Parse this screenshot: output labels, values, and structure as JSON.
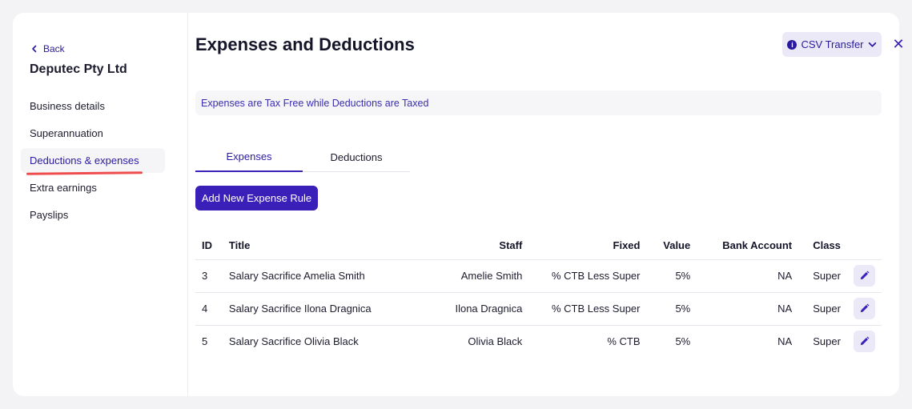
{
  "sidebar": {
    "back_label": "Back",
    "company": "Deputec Pty Ltd",
    "items": [
      {
        "label": "Business details"
      },
      {
        "label": "Superannuation"
      },
      {
        "label": "Deductions & expenses"
      },
      {
        "label": "Extra earnings"
      },
      {
        "label": "Payslips"
      }
    ],
    "active_index": 2
  },
  "header": {
    "title": "Expenses and Deductions",
    "csv_button": "CSV Transfer"
  },
  "banner": "Expenses are Tax Free while Deductions are Taxed",
  "tabs": [
    {
      "label": "Expenses"
    },
    {
      "label": "Deductions"
    }
  ],
  "add_button": "Add New Expense Rule",
  "table": {
    "headers": [
      "ID",
      "Title",
      "Staff",
      "Fixed",
      "Value",
      "Bank Account",
      "Class"
    ],
    "rows": [
      {
        "id": "3",
        "title": "Salary Sacrifice Amelia Smith",
        "staff": "Amelie Smith",
        "fixed": "% CTB Less Super",
        "value": "5%",
        "bank": "NA",
        "class": "Super"
      },
      {
        "id": "4",
        "title": "Salary Sacrifice Ilona Dragnica",
        "staff": "Ilona Dragnica",
        "fixed": "% CTB Less Super",
        "value": "5%",
        "bank": "NA",
        "class": "Super"
      },
      {
        "id": "5",
        "title": "Salary Sacrifice Olivia Black",
        "staff": "Olivia Black",
        "fixed": "% CTB",
        "value": "5%",
        "bank": "NA",
        "class": "Super"
      }
    ]
  },
  "colors": {
    "accent": "#3a1fb8",
    "highlight": "#ef4d4d"
  }
}
